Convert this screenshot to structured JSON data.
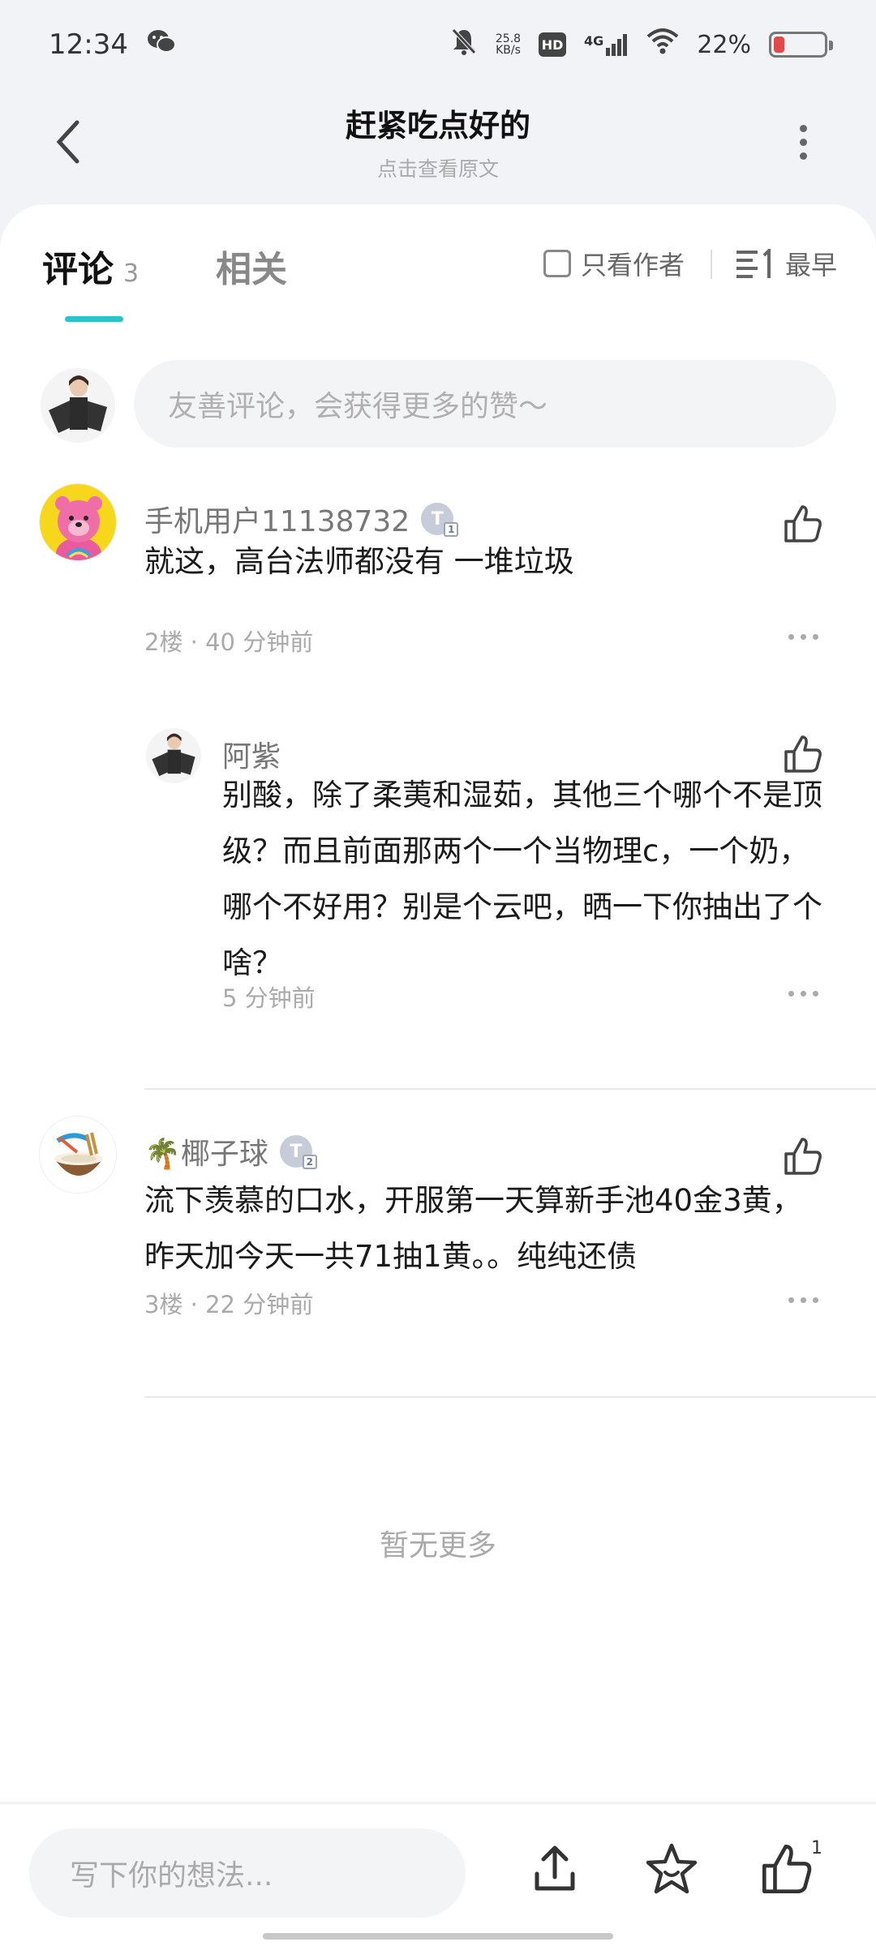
{
  "status_bar": {
    "time": "12:34",
    "net_speed_value": "25.8",
    "net_speed_unit": "KB/s",
    "hd_label": "HD",
    "network": "4G",
    "battery": "22%",
    "battery_level": 0.22
  },
  "header": {
    "title": "赶紧吃点好的",
    "subtitle": "点击查看原文"
  },
  "tabs": {
    "comments_label": "评论",
    "comments_count": "3",
    "related_label": "相关",
    "author_only_label": "只看作者",
    "sort_label": "最早"
  },
  "comment_box": {
    "placeholder": "友善评论，会获得更多的赞～"
  },
  "comments": [
    {
      "username": "手机用户11138732",
      "level": "1",
      "content": "就这，高台法师都没有 一堆垃圾",
      "meta": "2楼 · 40 分钟前"
    },
    {
      "username": "阿紫",
      "content": "别酸，除了柔荑和湿茹，其他三个哪个不是顶级？而且前面那两个一个当物理c，一个奶，哪个不好用？别是个云吧，晒一下你抽出了个啥？",
      "meta": "5 分钟前"
    },
    {
      "username": "🌴椰子球",
      "level": "2",
      "content": "流下羡慕的口水，开服第一天算新手池40金3黄，昨天加今天一共71抽1黄。。纯纯还债",
      "meta": "3楼 · 22 分钟前"
    }
  ],
  "no_more": "暂无更多",
  "bottom_bar": {
    "input_placeholder": "写下你的想法...",
    "like_count": "1"
  }
}
